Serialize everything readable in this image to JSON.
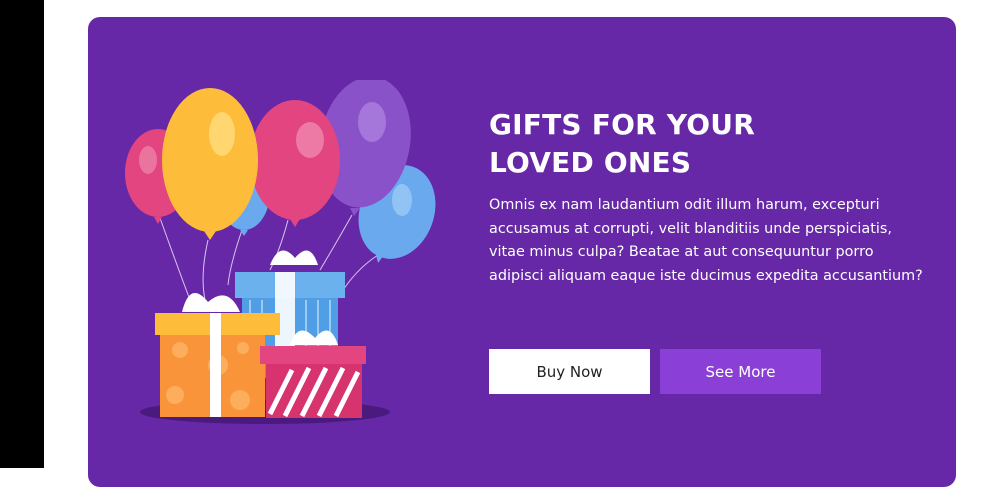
{
  "banner": {
    "title_line1": "GIFTS FOR YOUR",
    "title_line2": "LOVED ONES",
    "description": "Omnis ex nam laudantium odit illum harum, excepturi accusamus at corrupti, velit blanditiis unde perspiciatis, vitae minus culpa? Beatae at aut consequuntur porro adipisci aliquam eaque iste ducimus expedita accusantium?",
    "buy_now_label": "Buy Now",
    "see_more_label": "See More"
  },
  "colors": {
    "banner_bg": "#6628a6",
    "primary_button_bg": "#ffffff",
    "secondary_button_bg": "#8a3fd6"
  },
  "illustration": {
    "icon": "gifts-and-balloons-illustration"
  }
}
